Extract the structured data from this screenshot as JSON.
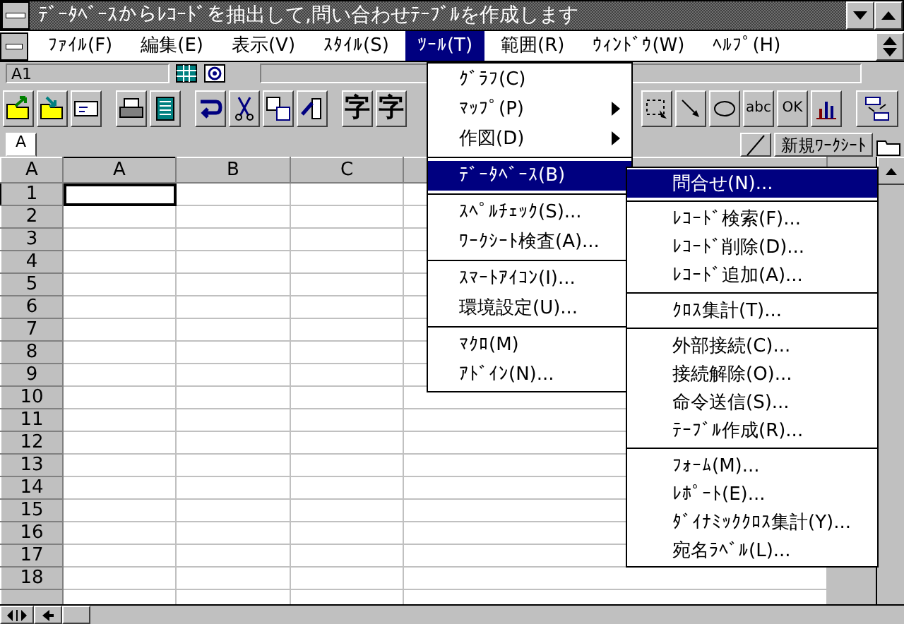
{
  "window": {
    "title": "ﾃﾞｰﾀﾍﾞｰｽからﾚｺｰﾄﾞを抽出して,問い合わせﾃｰﾌﾞﾙを作成します"
  },
  "menubar": [
    {
      "label": "ﾌｧｲﾙ(F)",
      "selected": false
    },
    {
      "label": "編集(E)",
      "selected": false
    },
    {
      "label": "表示(V)",
      "selected": false
    },
    {
      "label": "ｽﾀｲﾙ(S)",
      "selected": false
    },
    {
      "label": "ﾂｰﾙ(T)",
      "selected": true
    },
    {
      "label": "範囲(R)",
      "selected": false
    },
    {
      "label": "ｳｨﾝﾄﾞｳ(W)",
      "selected": false
    },
    {
      "label": "ﾍﾙﾌﾟ(H)",
      "selected": false
    }
  ],
  "formula_bar": {
    "cell_reference": "A1"
  },
  "toolbar": {
    "glyph_buttons": [
      "字",
      "字"
    ],
    "label_buttons": [
      "abc",
      "OK"
    ]
  },
  "sheet_tabs": [
    {
      "label": "A",
      "selected": true
    }
  ],
  "new_sheet_button": "新規ﾜｰｸｼｰﾄ",
  "grid": {
    "corner": "A",
    "columns": [
      {
        "label": "A",
        "selected": true
      },
      {
        "label": "B",
        "selected": false
      },
      {
        "label": "C",
        "selected": false
      }
    ],
    "rows": [
      {
        "label": "1",
        "selected": true
      },
      {
        "label": "2",
        "selected": false
      },
      {
        "label": "3",
        "selected": false
      },
      {
        "label": "4",
        "selected": false
      },
      {
        "label": "5",
        "selected": false
      },
      {
        "label": "6",
        "selected": false
      },
      {
        "label": "7",
        "selected": false
      },
      {
        "label": "8",
        "selected": false
      },
      {
        "label": "9",
        "selected": false
      },
      {
        "label": "10",
        "selected": false
      },
      {
        "label": "11",
        "selected": false
      },
      {
        "label": "12",
        "selected": false
      },
      {
        "label": "13",
        "selected": false
      },
      {
        "label": "14",
        "selected": false
      },
      {
        "label": "15",
        "selected": false
      },
      {
        "label": "16",
        "selected": false
      },
      {
        "label": "17",
        "selected": false
      },
      {
        "label": "18",
        "selected": false
      }
    ]
  },
  "tools_menu": [
    {
      "kind": "item",
      "label": "ｸﾞﾗﾌ(C)",
      "selected": false,
      "submenu": false
    },
    {
      "kind": "item",
      "label": "ﾏｯﾌﾟ(P)",
      "selected": false,
      "submenu": true
    },
    {
      "kind": "item",
      "label": "作図(D)",
      "selected": false,
      "submenu": true
    },
    {
      "kind": "separator"
    },
    {
      "kind": "item",
      "label": "ﾃﾞｰﾀﾍﾞｰｽ(B)",
      "selected": true,
      "submenu": false
    },
    {
      "kind": "separator"
    },
    {
      "kind": "item",
      "label": "ｽﾍﾟﾙﾁｪｯｸ(S)...",
      "selected": false,
      "submenu": false
    },
    {
      "kind": "item",
      "label": "ﾜｰｸｼｰﾄ検査(A)...",
      "selected": false,
      "submenu": false
    },
    {
      "kind": "separator"
    },
    {
      "kind": "item",
      "label": "ｽﾏｰﾄｱｲｺﾝ(I)...",
      "selected": false,
      "submenu": false
    },
    {
      "kind": "item",
      "label": "環境設定(U)...",
      "selected": false,
      "submenu": false
    },
    {
      "kind": "separator"
    },
    {
      "kind": "item",
      "label": "ﾏｸﾛ(M)",
      "selected": false,
      "submenu": false
    },
    {
      "kind": "item",
      "label": "ｱﾄﾞｲﾝ(N)...",
      "selected": false,
      "submenu": false
    }
  ],
  "database_submenu": [
    {
      "kind": "item",
      "label": "問合せ(N)...",
      "selected": true
    },
    {
      "kind": "separator"
    },
    {
      "kind": "item",
      "label": "ﾚｺｰﾄﾞ検索(F)...",
      "selected": false
    },
    {
      "kind": "item",
      "label": "ﾚｺｰﾄﾞ削除(D)...",
      "selected": false
    },
    {
      "kind": "item",
      "label": "ﾚｺｰﾄﾞ追加(A)...",
      "selected": false
    },
    {
      "kind": "separator"
    },
    {
      "kind": "item",
      "label": "ｸﾛｽ集計(T)...",
      "selected": false
    },
    {
      "kind": "separator"
    },
    {
      "kind": "item",
      "label": "外部接続(C)...",
      "selected": false
    },
    {
      "kind": "item",
      "label": "接続解除(O)...",
      "selected": false
    },
    {
      "kind": "item",
      "label": "命令送信(S)...",
      "selected": false
    },
    {
      "kind": "item",
      "label": "ﾃｰﾌﾞﾙ作成(R)...",
      "selected": false
    },
    {
      "kind": "separator"
    },
    {
      "kind": "item",
      "label": "ﾌｫｰﾑ(M)...",
      "selected": false
    },
    {
      "kind": "item",
      "label": "ﾚﾎﾟｰﾄ(E)...",
      "selected": false
    },
    {
      "kind": "item",
      "label": "ﾀﾞｲﾅﾐｯｸｸﾛｽ集計(Y)...",
      "selected": false
    },
    {
      "kind": "item",
      "label": "宛名ﾗﾍﾞﾙ(L)...",
      "selected": false
    }
  ]
}
